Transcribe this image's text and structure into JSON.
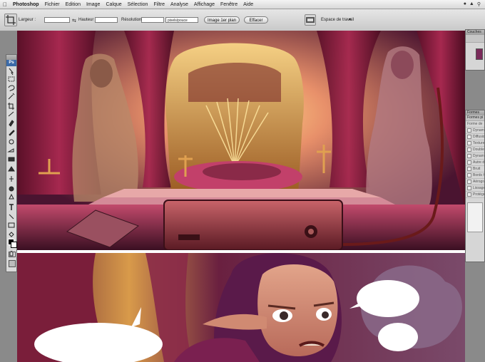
{
  "menubar": {
    "items": [
      "Photoshop",
      "Fichier",
      "Edition",
      "Image",
      "Calque",
      "Sélection",
      "Filtre",
      "Analyse",
      "Affichage",
      "Fenêtre",
      "Aide"
    ]
  },
  "options": {
    "largeur_label": "Largeur :",
    "hauteur_label": "Hauteur :",
    "resolution_label": "Résolution :",
    "unit_select": "pixels/pouce",
    "front_image_button": "Image 1er plan",
    "clear_button": "Effacer",
    "workspace_label": "Espace de travail"
  },
  "tools": {
    "badge": "Ps"
  },
  "right_panels": {
    "panel_top_header": "Couches",
    "panel_brush_header": "Formes",
    "brush_subheader": "Formes pi",
    "brush_rows": [
      "Forme de",
      "Dynamique",
      "Diffusion",
      "Texture",
      "Double",
      "Dynamique",
      "Autre dyn",
      "Bruit",
      "Bords hu",
      "Aérograp",
      "Lissage",
      "Protéger"
    ]
  },
  "colors": {
    "curtain": "#7a1e3a",
    "gold": "#d89a3a",
    "accent_pink": "#d8568a"
  }
}
